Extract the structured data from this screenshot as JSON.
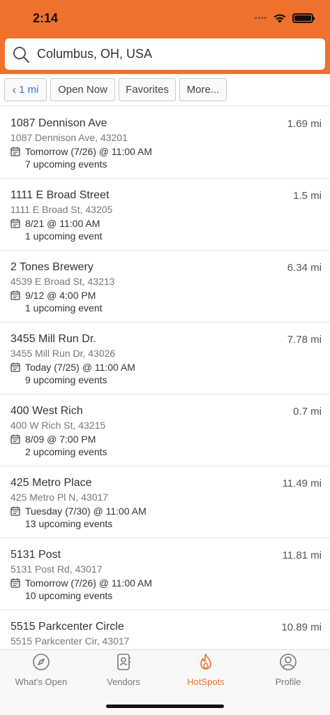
{
  "status_bar": {
    "time": "2:14"
  },
  "search": {
    "text": "Columbus, OH, USA"
  },
  "filters": {
    "distance": "1 mi",
    "open_now": "Open Now",
    "favorites": "Favorites",
    "more": "More..."
  },
  "colors": {
    "accent": "#f0712c",
    "link": "#2f78d6"
  },
  "hotspots": [
    {
      "name": "1087 Dennison Ave",
      "address": "1087 Dennison Ave, 43201",
      "next": "Tomorrow (7/26) @ 11:00 AM",
      "events": "7 upcoming events",
      "distance": "1.69 mi"
    },
    {
      "name": "1111 E Broad Street",
      "address": "1111 E Broad St, 43205",
      "next": "8/21 @ 11:00 AM",
      "events": "1 upcoming event",
      "distance": "1.5 mi"
    },
    {
      "name": "2 Tones Brewery",
      "address": "4539 E Broad St, 43213",
      "next": "9/12 @ 4:00 PM",
      "events": "1 upcoming event",
      "distance": "6.34 mi"
    },
    {
      "name": "3455 Mill Run Dr.",
      "address": "3455 Mill Run Dr, 43026",
      "next": "Today (7/25) @ 11:00 AM",
      "events": "9 upcoming events",
      "distance": "7.78 mi"
    },
    {
      "name": "400 West Rich",
      "address": "400 W Rich St, 43215",
      "next": "8/09 @ 7:00 PM",
      "events": "2 upcoming events",
      "distance": "0.7 mi"
    },
    {
      "name": "425 Metro Place",
      "address": "425 Metro Pl N, 43017",
      "next": "Tuesday (7/30) @ 11:00 AM",
      "events": "13 upcoming events",
      "distance": "11.49 mi"
    },
    {
      "name": "5131 Post",
      "address": "5131 Post Rd, 43017",
      "next": "Tomorrow (7/26) @ 11:00 AM",
      "events": "10 upcoming events",
      "distance": "11.81 mi"
    },
    {
      "name": "5515 Parkcenter Circle",
      "address": "5515 Parkcenter Cir, 43017",
      "next": "",
      "events": "",
      "distance": "10.89 mi"
    }
  ],
  "tabs": [
    {
      "label": "What's Open",
      "icon": "compass-icon"
    },
    {
      "label": "Vendors",
      "icon": "contacts-icon"
    },
    {
      "label": "HotSpots",
      "icon": "flame-icon",
      "active": true
    },
    {
      "label": "Profile",
      "icon": "user-icon"
    }
  ]
}
